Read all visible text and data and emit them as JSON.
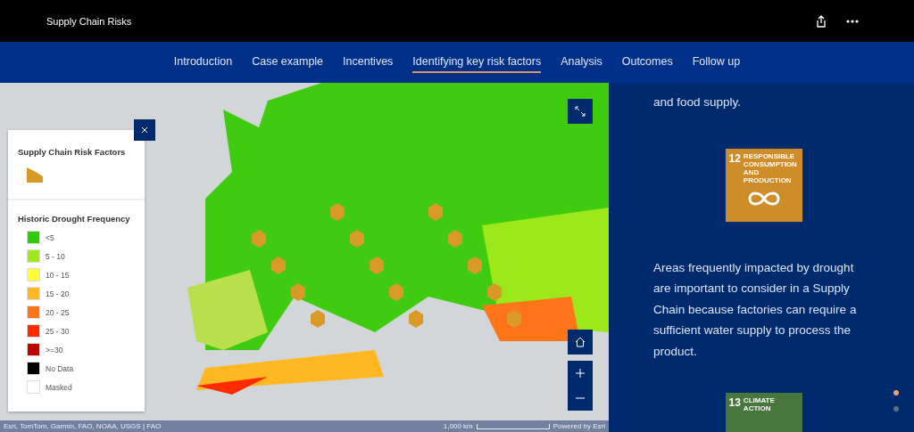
{
  "header": {
    "title": "Supply Chain Risks"
  },
  "nav": [
    {
      "label": "Introduction",
      "selected": false
    },
    {
      "label": "Case example",
      "selected": false
    },
    {
      "label": "Incentives",
      "selected": false
    },
    {
      "label": "Identifying key risk factors",
      "selected": true
    },
    {
      "label": "Analysis",
      "selected": false
    },
    {
      "label": "Outcomes",
      "selected": false
    },
    {
      "label": "Follow up",
      "selected": false
    }
  ],
  "legend": {
    "risk_title": "Supply Chain Risk Factors",
    "drought_title": "Historic Drought Frequency",
    "classes": [
      {
        "label": "<5",
        "color": "#2ecc00"
      },
      {
        "label": "5 - 10",
        "color": "#9de81a"
      },
      {
        "label": "10 - 15",
        "color": "#ffff33"
      },
      {
        "label": "15 - 20",
        "color": "#ffb822"
      },
      {
        "label": "20 - 25",
        "color": "#ff7518"
      },
      {
        "label": "25 - 30",
        "color": "#ff2a00"
      },
      {
        "label": ">=30",
        "color": "#c00000"
      },
      {
        "label": "No Data",
        "color": "#000000"
      },
      {
        "label": "Masked",
        "color": "#ffffff"
      }
    ]
  },
  "map": {
    "attribution": "Esri, TomTom, Garmin, FAO, NOAA, USGS | FAO",
    "scale": "1,000 km",
    "powered": "Powered by Esri"
  },
  "panel": {
    "paragraphs": [
      "and food supply.",
      "Areas frequently impacted by drought are important to consider in a Supply Chain because factories can require a sufficient water supply to process the product."
    ],
    "goals": [
      {
        "number": "12",
        "label": "RESPONSIBLE CONSUMPTION AND PRODUCTION",
        "color": "#cf8d2a"
      },
      {
        "number": "13",
        "label": "CLIMATE ACTION",
        "color": "#48773e"
      }
    ],
    "dots": [
      {
        "selected": true
      },
      {
        "selected": false
      }
    ]
  }
}
